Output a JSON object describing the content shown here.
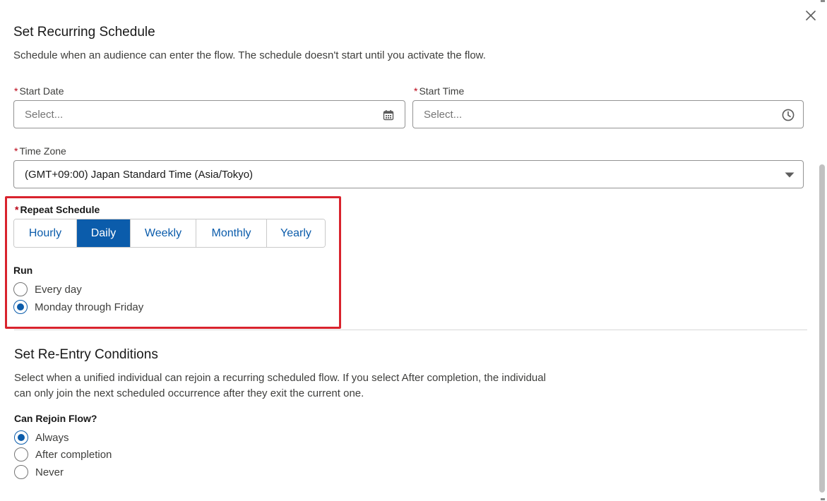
{
  "schedule": {
    "title": "Set Recurring Schedule",
    "description": "Schedule when an audience can enter the flow. The schedule doesn't start until you activate the flow.",
    "start_date": {
      "required_mark": "*",
      "label": "Start Date",
      "placeholder": "Select...",
      "icon": "calendar-icon"
    },
    "start_time": {
      "required_mark": "*",
      "label": "Start Time",
      "placeholder": "Select...",
      "icon": "clock-icon"
    },
    "time_zone": {
      "required_mark": "*",
      "label": "Time Zone",
      "value": "(GMT+09:00) Japan Standard Time (Asia/Tokyo)",
      "icon": "chevron-down-icon"
    },
    "repeat": {
      "required_mark": "*",
      "label": "Repeat Schedule",
      "options": [
        "Hourly",
        "Daily",
        "Weekly",
        "Monthly",
        "Yearly"
      ],
      "selected": "Daily"
    },
    "run": {
      "label": "Run",
      "options": [
        "Every day",
        "Monday through Friday"
      ],
      "selected": "Monday through Friday"
    }
  },
  "reentry": {
    "title": "Set Re-Entry Conditions",
    "description_line1": "Select when a unified individual can rejoin a recurring scheduled flow. If you select After completion, the individual",
    "description_line2": "can only join the next scheduled occurrence after they exit the current one.",
    "rejoin": {
      "label": "Can Rejoin Flow?",
      "options": [
        "Always",
        "After completion",
        "Never"
      ],
      "selected": "Always"
    }
  },
  "colors": {
    "brand": "#0b5cab",
    "required": "#ba0517",
    "highlight": "#d9232d"
  }
}
